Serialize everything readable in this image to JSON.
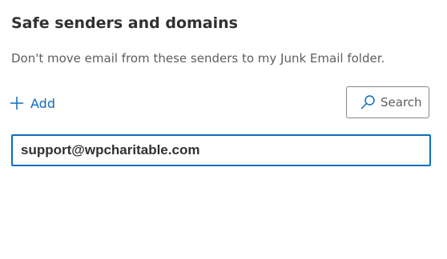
{
  "section": {
    "title": "Safe senders and domains",
    "description": "Don't move email from these senders to my Junk Email folder."
  },
  "toolbar": {
    "add_label": "Add",
    "add_icon": "plus-icon",
    "search_placeholder": "Search",
    "search_icon": "search-icon"
  },
  "entry": {
    "value": "support@wpcharitable.com"
  },
  "colors": {
    "accent": "#0f6cbd",
    "text": "#323130",
    "secondary_text": "#605e5c",
    "border": "#8a8886"
  }
}
